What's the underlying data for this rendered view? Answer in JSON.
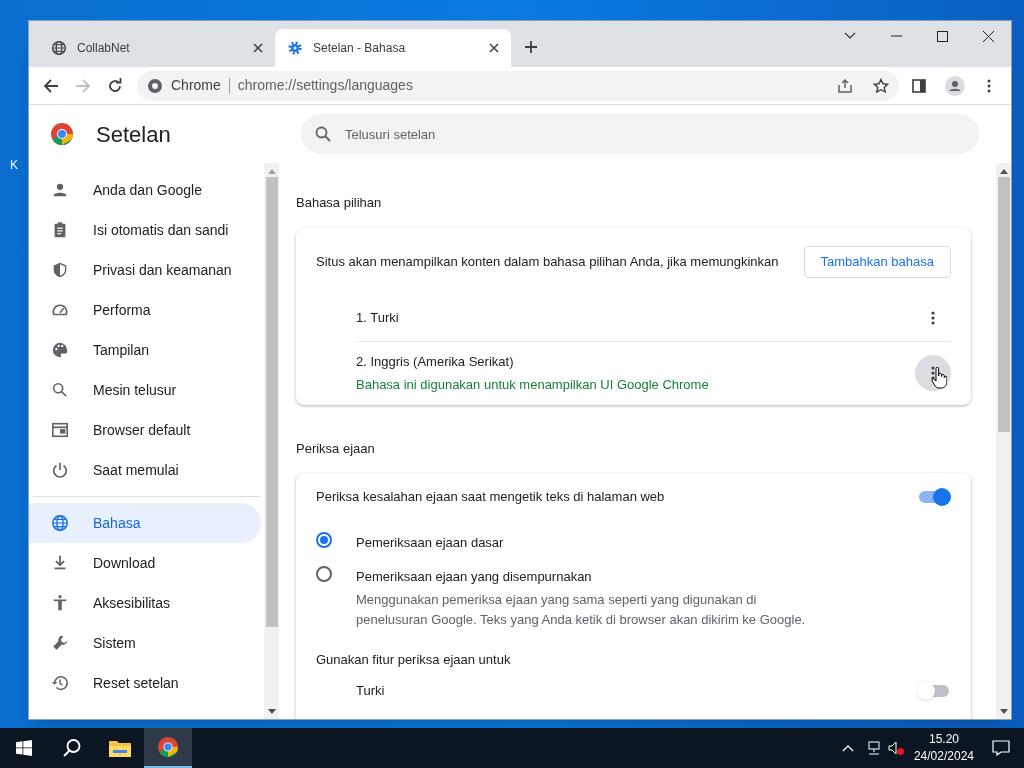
{
  "desktop": {
    "label_fragment": "K"
  },
  "window": {
    "tabs": [
      {
        "title": "CollabNet",
        "selected": false
      },
      {
        "title": "Setelan - Bahasa",
        "selected": true
      }
    ],
    "address": {
      "site": "Chrome",
      "url": "chrome://settings/languages"
    }
  },
  "sidebar": {
    "title": "Setelan",
    "items": [
      {
        "label": "Anda dan Google",
        "selected": false
      },
      {
        "label": "Isi otomatis dan sandi",
        "selected": false
      },
      {
        "label": "Privasi dan keamanan",
        "selected": false
      },
      {
        "label": "Performa",
        "selected": false
      },
      {
        "label": "Tampilan",
        "selected": false
      },
      {
        "label": "Mesin telusur",
        "selected": false
      },
      {
        "label": "Browser default",
        "selected": false
      },
      {
        "label": "Saat memulai",
        "selected": false
      },
      {
        "label": "Bahasa",
        "selected": true,
        "divider_before": true
      },
      {
        "label": "Download",
        "selected": false
      },
      {
        "label": "Aksesibilitas",
        "selected": false
      },
      {
        "label": "Sistem",
        "selected": false
      },
      {
        "label": "Reset setelan",
        "selected": false
      }
    ]
  },
  "main": {
    "search": {
      "placeholder": "Telusuri setelan"
    },
    "preferred": {
      "heading": "Bahasa pilihan",
      "description": "Situs akan menampilkan konten dalam bahasa pilihan Anda, jika memungkinkan",
      "button": "Tambahkan bahasa",
      "languages": [
        {
          "label": "1. Turki",
          "hovered": false
        },
        {
          "label": "2. Inggris (Amerika Serikat)",
          "note": "Bahasa ini digunakan untuk menampilkan UI Google Chrome",
          "hovered": true
        }
      ]
    },
    "spellcheck": {
      "heading": "Periksa ejaan",
      "toggle": {
        "label": "Periksa kesalahan ejaan saat mengetik teks di halaman web",
        "on": true
      },
      "options": [
        {
          "label": "Pemeriksaan ejaan dasar",
          "selected": true
        },
        {
          "label": "Pemeriksaan ejaan yang disempurnakan",
          "description": "Menggunakan pemeriksa ejaan yang sama seperti yang digunakan di penelusuran Google. Teks yang Anda ketik di browser akan dikirim ke Google.",
          "selected": false
        }
      ],
      "subheading": "Gunakan fitur periksa ejaan untuk",
      "languages": [
        {
          "label": "Turki",
          "on": false
        }
      ]
    }
  },
  "taskbar": {
    "time": "15.20",
    "date": "24/02/2024"
  }
}
